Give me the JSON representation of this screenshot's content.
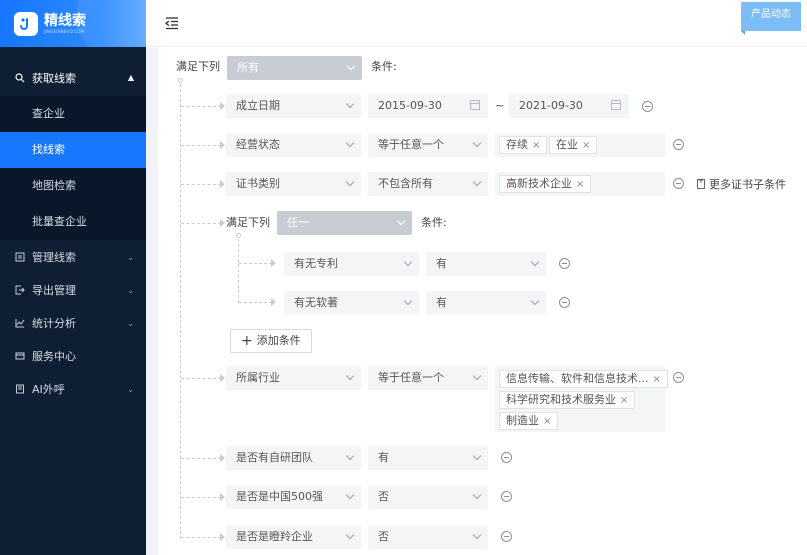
{
  "app": {
    "name": "精线索",
    "domain": "JINGXIANSUO.COM"
  },
  "header": {
    "news_label": "产品动态"
  },
  "sidebar": {
    "items": [
      {
        "label": "获取线索",
        "icon": "search-icon",
        "open": true,
        "children": [
          {
            "label": "查企业",
            "active": false
          },
          {
            "label": "找线索",
            "active": true
          },
          {
            "label": "地图检索",
            "active": false
          },
          {
            "label": "批量查企业",
            "active": false
          }
        ]
      },
      {
        "label": "管理线索",
        "icon": "list-icon"
      },
      {
        "label": "导出管理",
        "icon": "export-icon"
      },
      {
        "label": "统计分析",
        "icon": "chart-icon"
      },
      {
        "label": "服务中心",
        "icon": "service-icon"
      },
      {
        "label": "AI外呼",
        "icon": "phone-icon"
      }
    ]
  },
  "filter": {
    "root": {
      "prefix": "满足下列",
      "mode": "所有",
      "suffix": "条件:"
    },
    "rows": [
      {
        "field": "成立日期",
        "date_from": "2015-09-30",
        "sep": "~",
        "date_to": "2021-09-30"
      },
      {
        "field": "经营状态",
        "op": "等于任意一个",
        "tags": [
          "存续",
          "在业"
        ]
      },
      {
        "field": "证书类别",
        "op": "不包含所有",
        "tags": [
          "高新技术企业"
        ],
        "extra": "更多证书子条件"
      }
    ],
    "nested": {
      "prefix": "满足下列",
      "mode": "任一",
      "suffix": "条件:",
      "rows": [
        {
          "field": "有无专利",
          "op": "有"
        },
        {
          "field": "有无软著",
          "op": "有"
        }
      ],
      "add_label": "添加条件"
    },
    "rows2": [
      {
        "field": "所属行业",
        "op": "等于任意一个",
        "tags": [
          "信息传输、软件和信息技术...",
          "科学研究和技术服务业",
          "制造业"
        ]
      },
      {
        "field": "是否有自研团队",
        "op": "有"
      },
      {
        "field": "是否是中国500强",
        "op": "否"
      },
      {
        "field": "是否是瞪羚企业",
        "op": "否"
      }
    ]
  }
}
